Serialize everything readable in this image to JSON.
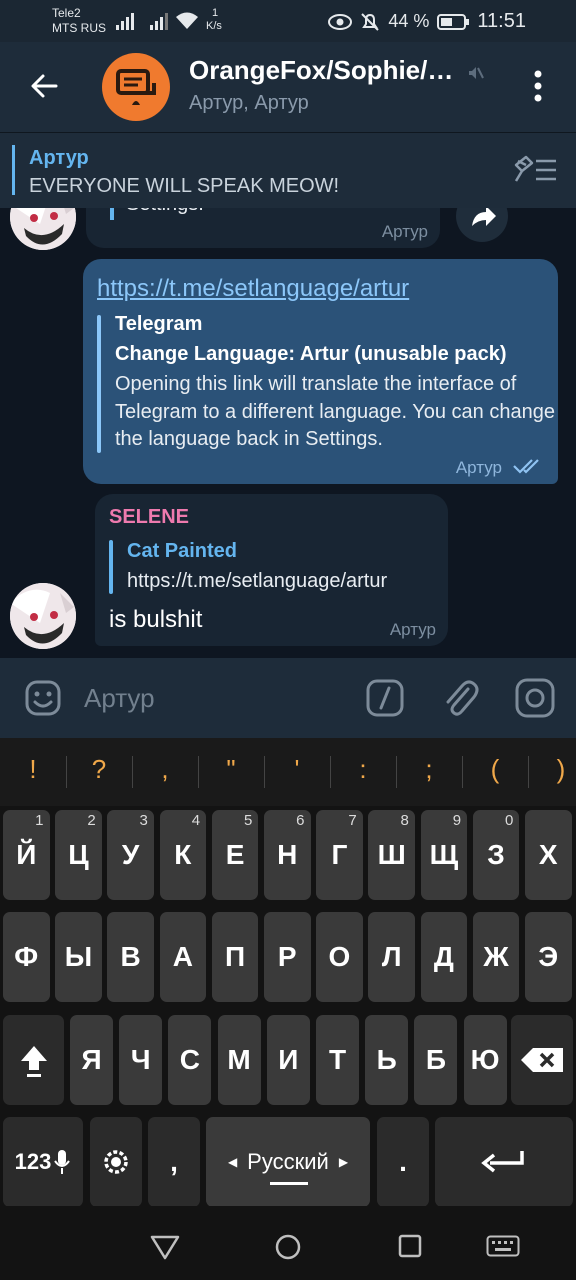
{
  "status_bar": {
    "carrier1": "Tele2",
    "carrier2": "MTS RUS",
    "net_speed_value": "1",
    "net_speed_unit": "K/s",
    "battery": "44 %",
    "time": "11:51",
    "icons": [
      "signal-icon",
      "signal-icon",
      "wifi-icon",
      "eye-icon",
      "bell-off-icon",
      "battery-icon"
    ]
  },
  "header": {
    "title": "OrangeFox/Sophie/…",
    "subtitle": "Артур, Артур"
  },
  "pinned": {
    "author": "Артур",
    "text": "EVERYONE WILL SPEAK MEOW!"
  },
  "messages": {
    "partial": {
      "text": "Settings.",
      "time": "Артур"
    },
    "outgoing": {
      "link": "https://t.me/setlanguage/artur",
      "preview_site": "Telegram",
      "preview_title": "Change Language: Artur (unusable pack)",
      "preview_desc": "Opening this link will translate the interface of Telegram to a different language. You can change the language back in Settings.",
      "time": "Артур"
    },
    "incoming": {
      "author": "SELENE",
      "reply_author": "Cat Painted",
      "reply_text": "https://t.me/setlanguage/artur",
      "text": "is bulshit",
      "time": "Артур"
    }
  },
  "input": {
    "placeholder": "Артур"
  },
  "keyboard": {
    "symbols": [
      "!",
      "?",
      ",",
      "\"",
      "'",
      ":",
      ";",
      "(",
      ")"
    ],
    "row1": [
      {
        "k": "Й",
        "h": "1"
      },
      {
        "k": "Ц",
        "h": "2"
      },
      {
        "k": "У",
        "h": "3"
      },
      {
        "k": "К",
        "h": "4"
      },
      {
        "k": "Е",
        "h": "5"
      },
      {
        "k": "Н",
        "h": "6"
      },
      {
        "k": "Г",
        "h": "7"
      },
      {
        "k": "Ш",
        "h": "8"
      },
      {
        "k": "Щ",
        "h": "9"
      },
      {
        "k": "З",
        "h": "0"
      },
      {
        "k": "Х",
        "h": ""
      }
    ],
    "row2": [
      "Ф",
      "Ы",
      "В",
      "А",
      "П",
      "Р",
      "О",
      "Л",
      "Д",
      "Ж",
      "Э"
    ],
    "row3": [
      "Я",
      "Ч",
      "С",
      "М",
      "И",
      "Т",
      "Ь",
      "Б",
      "Ю"
    ],
    "numbers_label": "123",
    "comma": ",",
    "space_label": "Русский",
    "period": "."
  }
}
